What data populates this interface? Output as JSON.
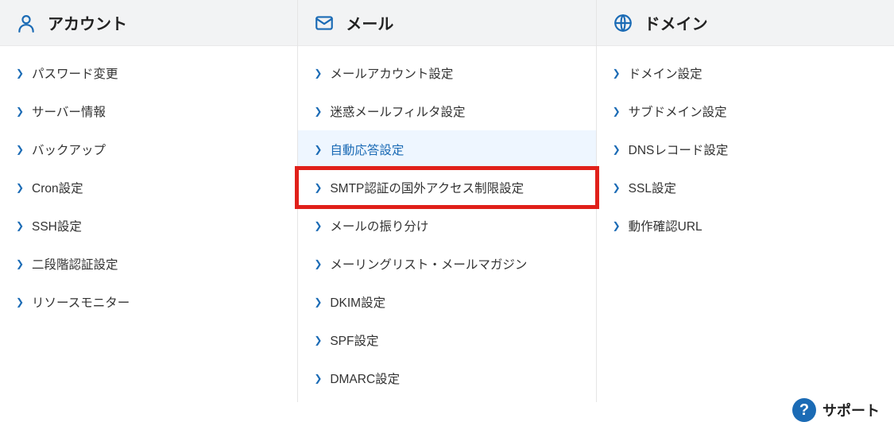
{
  "columns": [
    {
      "id": "account",
      "icon": "user-icon",
      "title": "アカウント",
      "items": [
        {
          "label": "パスワード変更"
        },
        {
          "label": "サーバー情報"
        },
        {
          "label": "バックアップ"
        },
        {
          "label": "Cron設定"
        },
        {
          "label": "SSH設定"
        },
        {
          "label": "二段階認証設定"
        },
        {
          "label": "リソースモニター"
        }
      ]
    },
    {
      "id": "mail",
      "icon": "mail-icon",
      "title": "メール",
      "items": [
        {
          "label": "メールアカウント設定"
        },
        {
          "label": "迷惑メールフィルタ設定"
        },
        {
          "label": "自動応答設定",
          "hovered": true
        },
        {
          "label": "SMTP認証の国外アクセス制限設定",
          "highlighted": true
        },
        {
          "label": "メールの振り分け"
        },
        {
          "label": "メーリングリスト・メールマガジン"
        },
        {
          "label": "DKIM設定"
        },
        {
          "label": "SPF設定"
        },
        {
          "label": "DMARC設定"
        }
      ]
    },
    {
      "id": "domain",
      "icon": "globe-icon",
      "title": "ドメイン",
      "items": [
        {
          "label": "ドメイン設定"
        },
        {
          "label": "サブドメイン設定"
        },
        {
          "label": "DNSレコード設定"
        },
        {
          "label": "SSL設定"
        },
        {
          "label": "動作確認URL"
        }
      ]
    }
  ],
  "support": {
    "label": "サポート"
  },
  "colors": {
    "accent": "#1b6bb5",
    "highlight_border": "#e0201a",
    "hover_bg": "#eef6ff"
  }
}
